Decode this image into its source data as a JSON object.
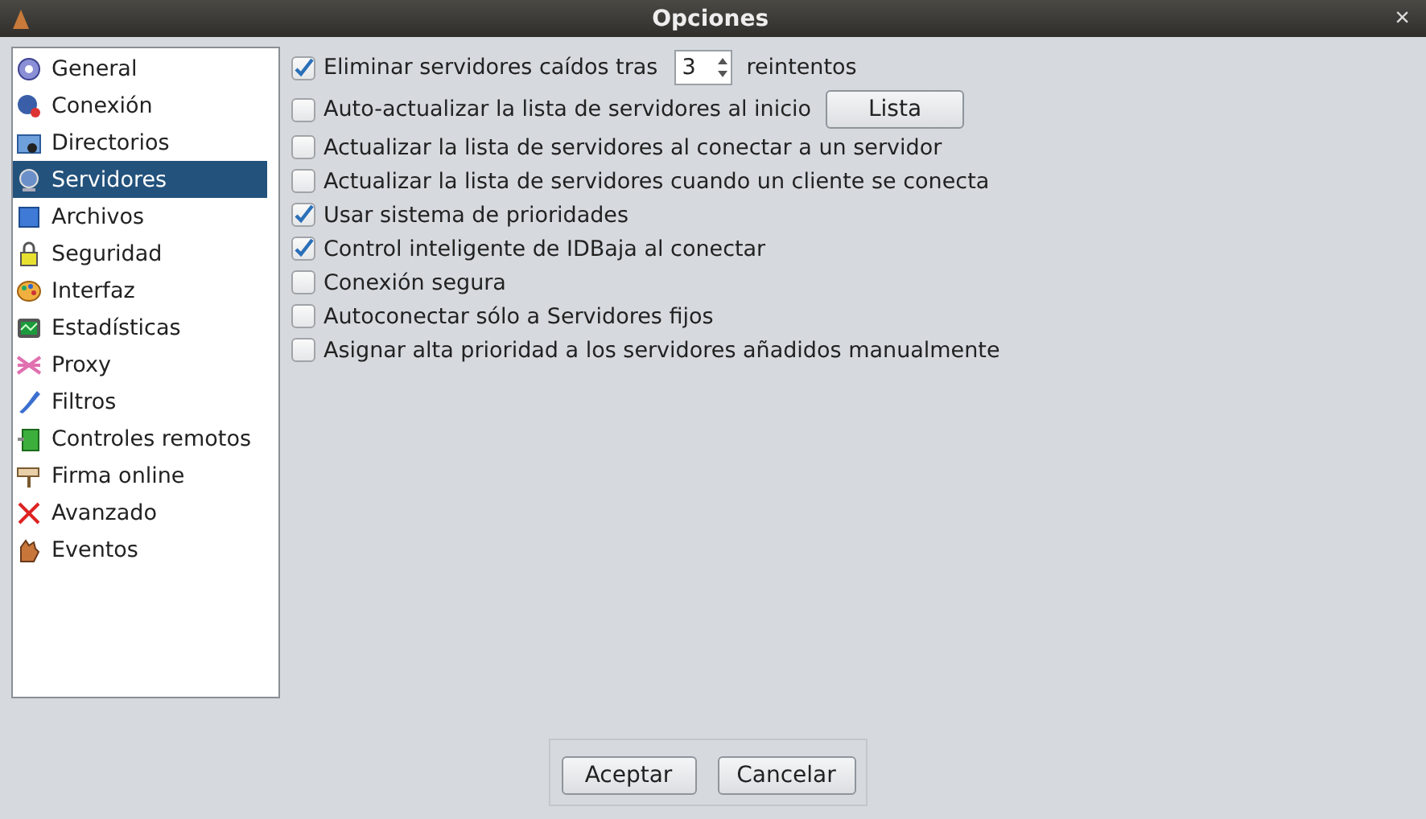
{
  "window": {
    "title": "Opciones",
    "close": "×"
  },
  "sidebar": {
    "items": [
      {
        "label": "General",
        "selected": false
      },
      {
        "label": "Conexión",
        "selected": false
      },
      {
        "label": "Directorios",
        "selected": false
      },
      {
        "label": "Servidores",
        "selected": true
      },
      {
        "label": "Archivos",
        "selected": false
      },
      {
        "label": "Seguridad",
        "selected": false
      },
      {
        "label": "Interfaz",
        "selected": false
      },
      {
        "label": "Estadísticas",
        "selected": false
      },
      {
        "label": "Proxy",
        "selected": false
      },
      {
        "label": "Filtros",
        "selected": false
      },
      {
        "label": "Controles remotos",
        "selected": false
      },
      {
        "label": "Firma online",
        "selected": false
      },
      {
        "label": "Avanzado",
        "selected": false
      },
      {
        "label": "Eventos",
        "selected": false
      }
    ]
  },
  "options": [
    {
      "kind": "spinner",
      "label": "Eliminar servidores caídos tras",
      "checked": true,
      "value": "3",
      "suffix": "reintentos"
    },
    {
      "kind": "button",
      "label": "Auto-actualizar la lista de servidores al inicio",
      "checked": false,
      "button": "Lista"
    },
    {
      "kind": "plain",
      "label": "Actualizar la lista de servidores al conectar a un servidor",
      "checked": false
    },
    {
      "kind": "plain",
      "label": "Actualizar la lista de servidores cuando un cliente se conecta",
      "checked": false
    },
    {
      "kind": "plain",
      "label": "Usar sistema de prioridades",
      "checked": true
    },
    {
      "kind": "plain",
      "label": "Control inteligente de IDBaja al conectar",
      "checked": true
    },
    {
      "kind": "plain",
      "label": "Conexión segura",
      "checked": false
    },
    {
      "kind": "plain",
      "label": "Autoconectar sólo a Servidores fijos",
      "checked": false
    },
    {
      "kind": "plain",
      "label": "Asignar alta prioridad a los servidores añadidos manualmente",
      "checked": false
    }
  ],
  "buttons": [
    "Aceptar",
    "Cancelar"
  ]
}
